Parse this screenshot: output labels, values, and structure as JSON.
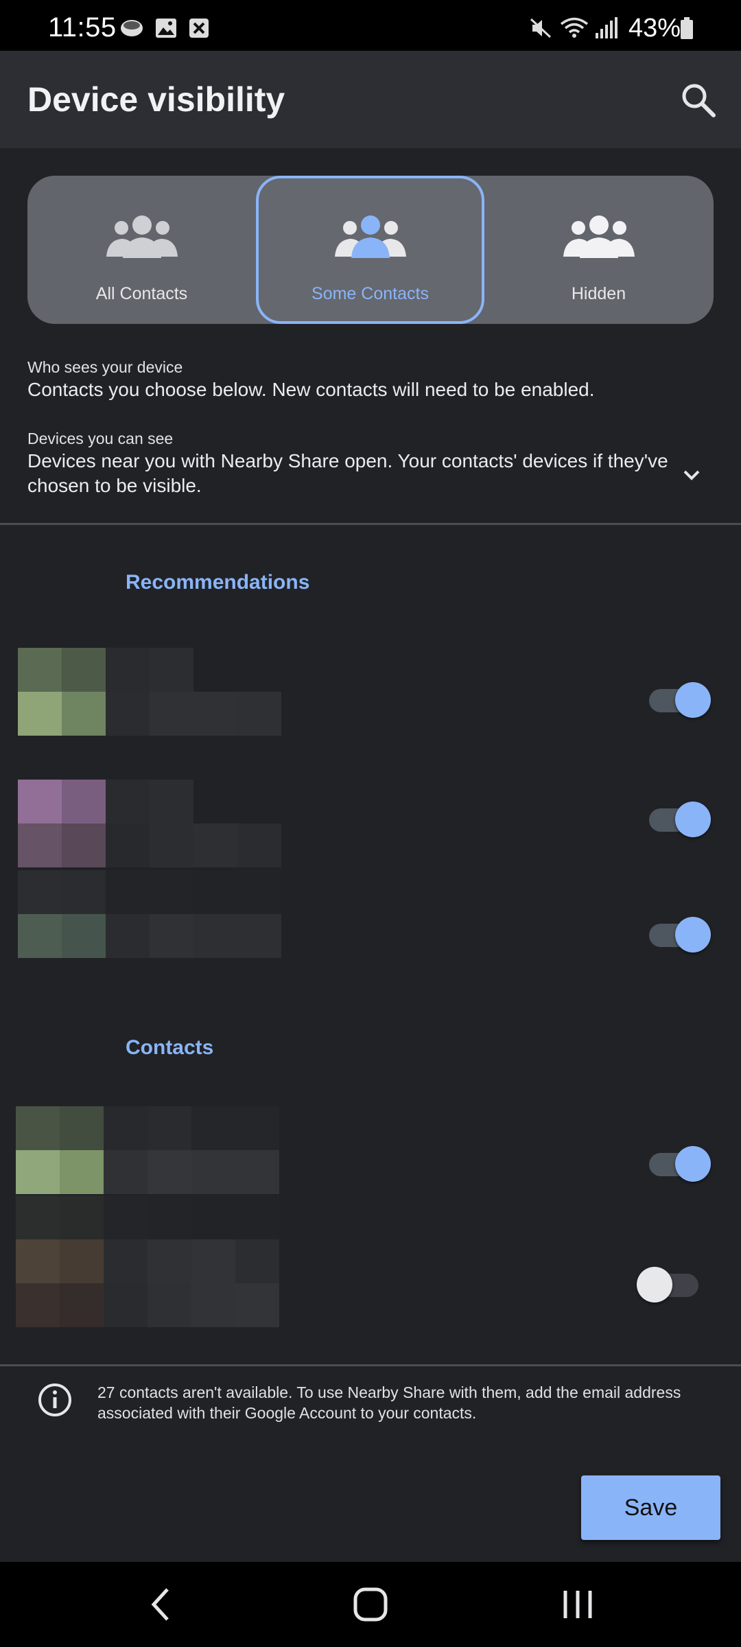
{
  "status_bar": {
    "time": "11:55",
    "battery": "43%",
    "icons": [
      "messenger-icon",
      "image-icon",
      "notification-x-icon",
      "mute-icon",
      "wifi-icon",
      "signal-icon",
      "battery-icon"
    ]
  },
  "app_bar": {
    "title": "Device visibility",
    "search_icon": "search-icon"
  },
  "visibility": {
    "options": [
      {
        "label": "All Contacts",
        "icon": "people-icon",
        "selected": false
      },
      {
        "label": "Some Contacts",
        "icon": "people-icon",
        "selected": true
      },
      {
        "label": "Hidden",
        "icon": "people-icon",
        "selected": false
      }
    ]
  },
  "info": {
    "who_label": "Who sees your device",
    "who_text": "Contacts you choose below. New contacts will need to be enabled.",
    "devices_label": "Devices you can see",
    "devices_text_1": "Devices near you with Nearby Share open. Your contacts' devices if they've",
    "devices_text_2": "chosen to be visible."
  },
  "sections": {
    "recommendations": "Recommendations",
    "contacts": "Contacts"
  },
  "toggles": {
    "recommendations": [
      true,
      true,
      true
    ],
    "contacts": [
      true,
      false
    ]
  },
  "notice": {
    "line1": "27 contacts aren't available. To use Nearby Share with them, add the email address",
    "line2": "associated with their Google Account to your contacts."
  },
  "actions": {
    "save": "Save"
  },
  "colors": {
    "accent": "#8ab4f8",
    "background": "#212226",
    "app_bar": "#2d2e33",
    "selector": "#62656b"
  }
}
